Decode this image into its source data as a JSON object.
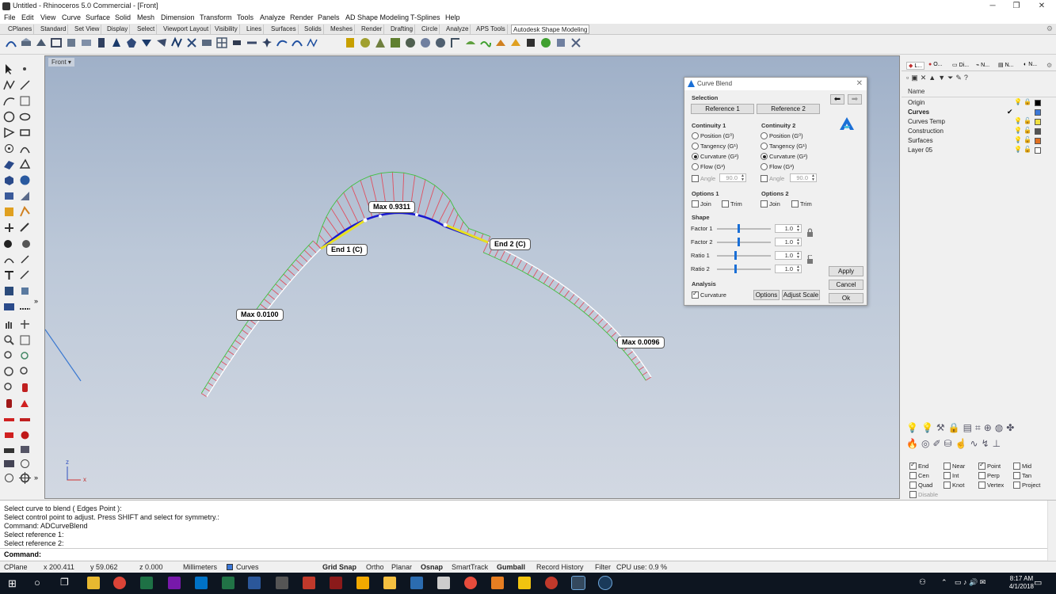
{
  "window": {
    "title": "Untitled - Rhinoceros 5.0 Commercial - [Front]",
    "minimize": "─",
    "maximize": "❐",
    "close": "✕"
  },
  "menu": [
    "File",
    "Edit",
    "View",
    "Curve",
    "Surface",
    "Solid",
    "Mesh",
    "Dimension",
    "Transform",
    "Tools",
    "Analyze",
    "Render",
    "Panels",
    "AD Shape Modeling",
    "T-Splines",
    "Help"
  ],
  "tabs": [
    "CPlanes",
    "Standard",
    "Set View",
    "Display",
    "Select",
    "Viewport Layout",
    "Visibility",
    "Lines",
    "Surfaces",
    "Solids",
    "Meshes",
    "Render",
    "Drafting",
    "Circle",
    "Analyze",
    "APS Tools",
    "Autodesk Shape Modeling"
  ],
  "active_tab": "Autodesk Shape Modeling",
  "viewport": {
    "label": "Front",
    "axis_z": "z",
    "axis_x": "x"
  },
  "annotations": {
    "max_center": "Max 0.9311",
    "end1": "End 1 (C)",
    "end2": "End 2 (C)",
    "max_left": "Max 0.0100",
    "max_right": "Max 0.0096"
  },
  "dialog": {
    "title": "Curve Blend",
    "close": "✕",
    "selection_label": "Selection",
    "reference1": "Reference 1",
    "reference2": "Reference 2",
    "continuity1_label": "Continuity 1",
    "continuity2_label": "Continuity 2",
    "continuity_options": [
      "Position (G⁰)",
      "Tangency (G¹)",
      "Curvature (G²)",
      "Flow (G³)"
    ],
    "continuity1_selected": 2,
    "continuity2_selected": 2,
    "angle_label": "Angle",
    "angle1": "90.0",
    "angle2": "90.0",
    "options1_label": "Options 1",
    "options2_label": "Options 2",
    "join": "Join",
    "trim": "Trim",
    "shape_label": "Shape",
    "shape_rows": [
      {
        "label": "Factor 1",
        "value": "1.0",
        "level": 0.4
      },
      {
        "label": "Factor 2",
        "value": "1.0",
        "level": 0.4
      },
      {
        "label": "Ratio 1",
        "value": "1.0",
        "level": 0.35
      },
      {
        "label": "Ratio 2",
        "value": "1.0",
        "level": 0.35
      }
    ],
    "analysis_label": "Analysis",
    "curvature": "Curvature",
    "options_btn": "Options",
    "adjust_scale_btn": "Adjust Scale",
    "apply": "Apply",
    "cancel": "Cancel",
    "ok": "Ok"
  },
  "layers_panel": {
    "tabs": [
      "L...",
      "O...",
      "Di...",
      "N...",
      "N...",
      "N..."
    ],
    "header": "Name",
    "layers": [
      {
        "name": "Origin",
        "color": "#000000",
        "current": false,
        "bold": false
      },
      {
        "name": "Curves",
        "color": "#3c78d8",
        "current": true,
        "bold": true
      },
      {
        "name": "Curves Temp",
        "color": "#f0e040",
        "current": false,
        "bold": false
      },
      {
        "name": "Construction",
        "color": "#555555",
        "current": false,
        "bold": false
      },
      {
        "name": "Surfaces",
        "color": "#e07020",
        "current": false,
        "bold": false
      },
      {
        "name": "Layer 05",
        "color": "#ffffff",
        "current": false,
        "bold": false
      }
    ],
    "current_mark": "✔"
  },
  "osnap": {
    "items": [
      {
        "label": "End",
        "on": true
      },
      {
        "label": "Near",
        "on": false
      },
      {
        "label": "Point",
        "on": true
      },
      {
        "label": "Mid",
        "on": false
      },
      {
        "label": "Cen",
        "on": false
      },
      {
        "label": "Int",
        "on": false
      },
      {
        "label": "Perp",
        "on": false
      },
      {
        "label": "Tan",
        "on": false
      },
      {
        "label": "Quad",
        "on": false
      },
      {
        "label": "Knot",
        "on": false
      },
      {
        "label": "Vertex",
        "on": false
      },
      {
        "label": "Project",
        "on": false
      }
    ],
    "disable": "Disable"
  },
  "command_history": [
    "Select curve to blend ( Edges  Point ):",
    "Select control point to adjust. Press SHIFT and select for symmetry.:",
    "Command: ADCurveBlend",
    "Select reference 1:",
    "Select reference 2:"
  ],
  "command_prompt": "Command:",
  "status": {
    "cplane": "CPlane",
    "x": "x 200.411",
    "y": "y 59.062",
    "z": "z 0.000",
    "units": "Millimeters",
    "layer": "Curves",
    "layer_color": "#3c78d8",
    "grid_snap": "Grid Snap",
    "ortho": "Ortho",
    "planar": "Planar",
    "osnap": "Osnap",
    "smarttrack": "SmartTrack",
    "gumball": "Gumball",
    "record_history": "Record History",
    "filter": "Filter",
    "cpu": "CPU use: 0.9 %"
  },
  "taskbar": {
    "time": "8:17 AM",
    "date": "4/1/2018"
  },
  "colors": {
    "accent": "#1a6fd6",
    "curve_blend": "#1a1ad0",
    "comb": "#e05060",
    "comb_outline": "#40c040",
    "handle": "#e8e020"
  }
}
